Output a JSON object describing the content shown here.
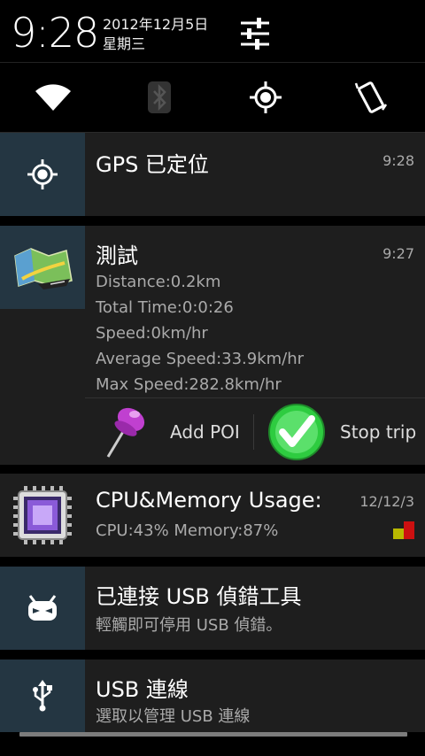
{
  "header": {
    "time": "9:28",
    "date": "2012年12月5日",
    "weekday": "星期三",
    "settings_icon": "sliders-icon"
  },
  "quick_toggles": [
    {
      "name": "wifi",
      "icon": "wifi-icon"
    },
    {
      "name": "bluetooth",
      "icon": "bluetooth-icon"
    },
    {
      "name": "gps",
      "icon": "gps-icon"
    },
    {
      "name": "auto-rotate",
      "icon": "rotate-icon"
    }
  ],
  "notifications": {
    "gps": {
      "title": "GPS 已定位",
      "time": "9:28"
    },
    "trip": {
      "title": "測試",
      "time": "9:27",
      "lines": [
        "Distance:0.2km",
        "Total Time:0:0:26",
        "Speed:0km/hr",
        "Average Speed:33.9km/hr",
        "Max Speed:282.8km/hr"
      ],
      "actions": {
        "add_poi": "Add POI",
        "stop_trip": "Stop trip"
      }
    },
    "cpu": {
      "title": "CPU&Memory Usage:",
      "time": "12/12/3",
      "subtitle": "CPU:43% Memory:87%"
    },
    "usb_debug": {
      "title": "已連接 USB 偵錯工具",
      "subtitle": "輕觸即可停用 USB 偵錯。"
    },
    "usb_conn": {
      "title": "USB 連線",
      "subtitle": "選取以管理 USB 連線"
    }
  },
  "colors": {
    "icon_bg": "#243642",
    "card_bg": "#1e1e1e",
    "green": "#2ecc40",
    "purple": "#b030c0"
  }
}
